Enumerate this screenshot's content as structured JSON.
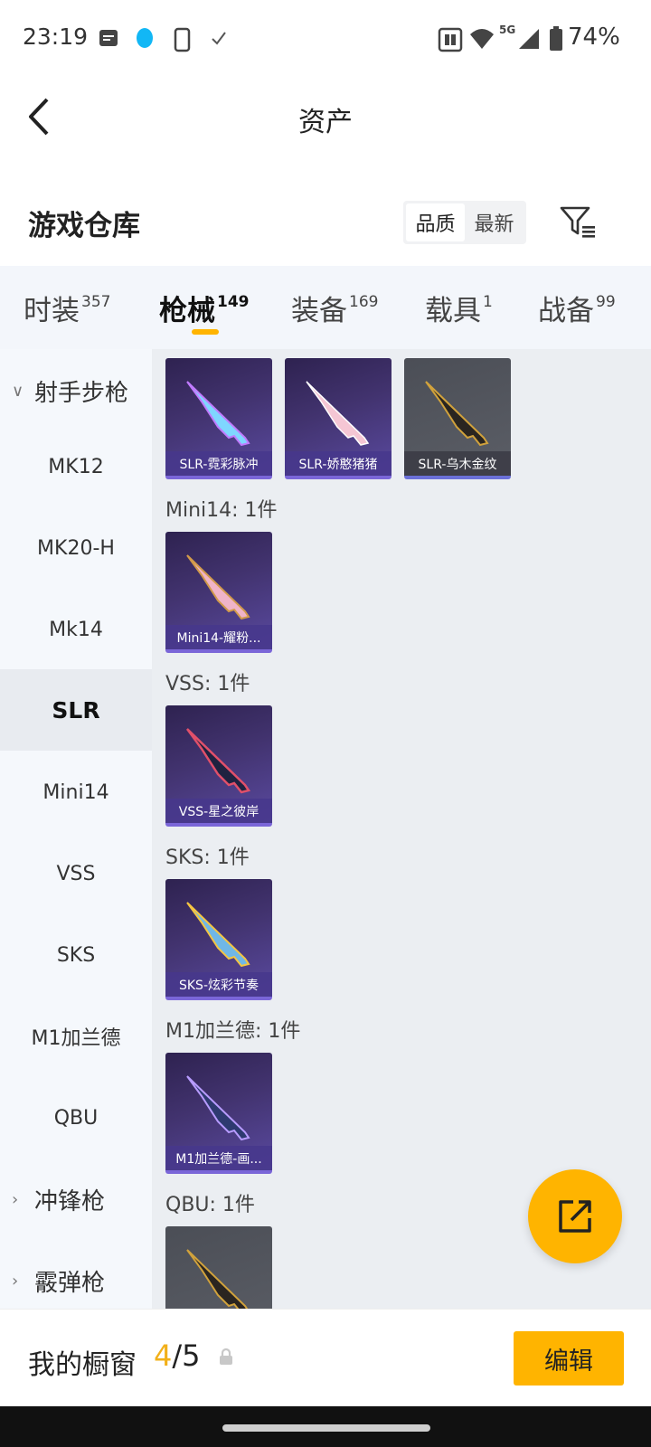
{
  "status_bar": {
    "time": "23:19",
    "battery": "74%",
    "network": "5G"
  },
  "header": {
    "title": "资产"
  },
  "section": {
    "title": "游戏仓库",
    "sort_quality": "品质",
    "sort_latest": "最新"
  },
  "tabs": [
    {
      "label": "时装",
      "count": "357"
    },
    {
      "label": "枪械",
      "count": "149"
    },
    {
      "label": "装备",
      "count": "169"
    },
    {
      "label": "载具",
      "count": "1"
    },
    {
      "label": "战备",
      "count": "99"
    }
  ],
  "sidebar": {
    "group_rifle": "射手步枪",
    "items": [
      "MK12",
      "MK20-H",
      "Mk14",
      "SLR",
      "Mini14",
      "VSS",
      "SKS",
      "M1加兰德",
      "QBU"
    ],
    "group_smg": "冲锋枪",
    "group_shotgun": "霰弹枪"
  },
  "content": {
    "slr_items": [
      "SLR-霓彩脉冲",
      "SLR-娇憨猪猪",
      "SLR-乌木金纹"
    ],
    "groups": [
      {
        "label": "Mini14: 1件",
        "item": "Mini14-耀粉..."
      },
      {
        "label": "VSS: 1件",
        "item": "VSS-星之彼岸"
      },
      {
        "label": "SKS: 1件",
        "item": "SKS-炫彩节奏"
      },
      {
        "label": "M1加兰德: 1件",
        "item": "M1加兰德-画..."
      },
      {
        "label": "QBU: 1件",
        "item": ""
      }
    ]
  },
  "bottom_bar": {
    "label": "我的橱窗",
    "current": "4",
    "total": "/5",
    "edit": "编辑"
  },
  "colors": {
    "accent": "#ffb400",
    "tab_bg": "#f3f6fb",
    "card": "#42336f"
  },
  "icons": [
    "back-arrow-icon",
    "filter-icon",
    "share-icon",
    "lock-icon",
    "chevron-down-icon",
    "chevron-right-icon"
  ]
}
